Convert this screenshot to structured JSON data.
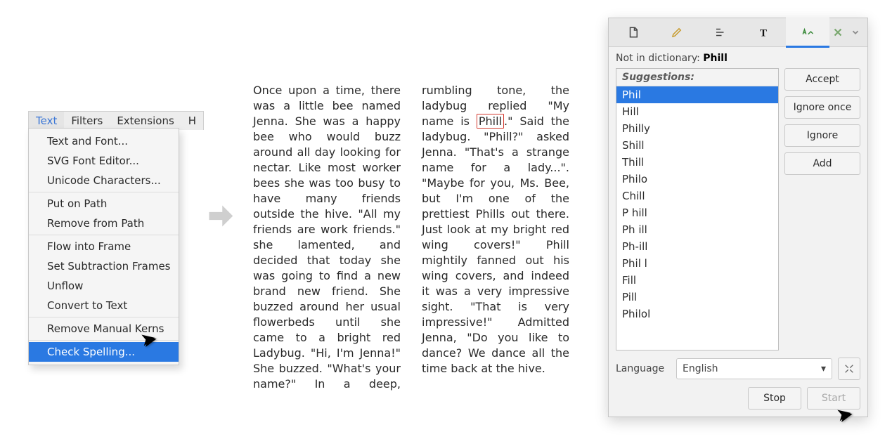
{
  "menubar": {
    "tabs": [
      "Text",
      "Filters",
      "Extensions",
      "H"
    ],
    "selected": 0
  },
  "menu": {
    "items": [
      "Text and Font...",
      "SVG Font Editor...",
      "Unicode Characters...",
      "Put on Path",
      "Remove from Path",
      "Flow into Frame",
      "Set Subtraction Frames",
      "Unflow",
      "Convert to Text",
      "Remove Manual Kerns",
      "Check Spelling..."
    ],
    "dividers_after": [
      2,
      4,
      8,
      9
    ],
    "highlighted": 10
  },
  "story": {
    "pre": "Once upon a time, there was a little bee named Jenna. She was a happy bee who would buzz around all day looking for nectar. Like most worker bees she was too busy to have many friends outside the hive. \"All my friends are work friends.\" she lamented, and decided that today she was going to find a new brand new friend. She buzzed around her usual flowerbeds until she came to a bright red Ladybug. \"Hi, I'm Jenna!\" She buzzed. \"What's your name?\" In a deep, rumbling tone, the ladybug replied \"My name is ",
    "err": "Phill",
    "post": ".\" Said the ladybug. \"Phill?\" asked Jenna. \"That's a strange name for a lady...\". \"Maybe for you, Ms. Bee, but I'm one of the prettiest Phills out there. Just look at my bright red wing covers!\" Phill mightily fanned out his wing covers, and indeed it was a very impressive sight. \"That is very impressive!\" Admitted Jenna, \"Do you like to dance? We dance all the time back at the hive."
  },
  "dialog": {
    "not_in_dict_label": "Not in dictionary:",
    "not_in_dict_word": "Phill",
    "sug_header": "Suggestions:",
    "suggestions": [
      "Phil",
      "Hill",
      "Philly",
      "Shill",
      "Thill",
      "Philo",
      "Chill",
      "P hill",
      "Ph ill",
      "Ph-ill",
      "Phil l",
      "Fill",
      "Pill",
      "Philol"
    ],
    "selected": 0,
    "buttons": {
      "accept": "Accept",
      "ignore_once": "Ignore once",
      "ignore": "Ignore",
      "add": "Add",
      "stop": "Stop",
      "start": "Start"
    },
    "lang_label": "Language",
    "lang_value": "English"
  }
}
